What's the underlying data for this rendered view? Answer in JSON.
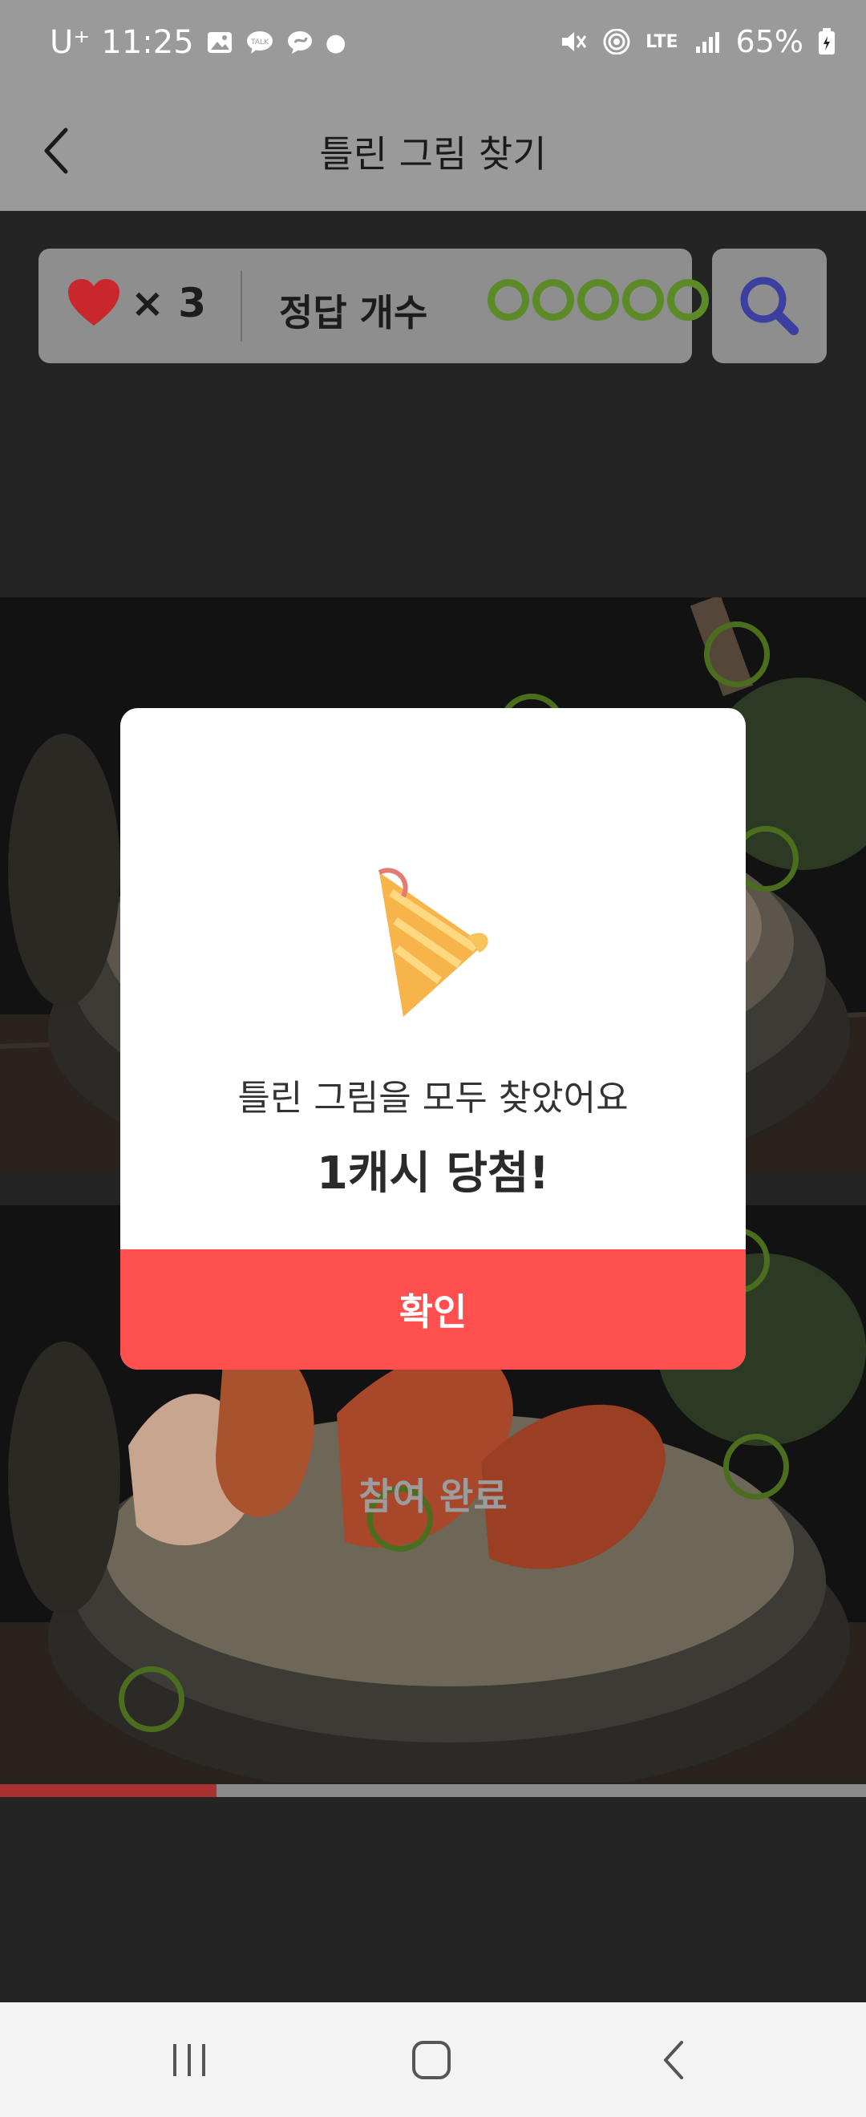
{
  "status_bar": {
    "carrier": "U⁺",
    "time": "11:25",
    "network": "LTE",
    "battery": "65%"
  },
  "header": {
    "title": "틀린 그림 찾기",
    "back_icon": "chevron-left-icon"
  },
  "game_bar": {
    "lives_icon": "heart-icon",
    "lives_count": "× 3",
    "answer_label": "정답 개수",
    "answers_found": 5,
    "search_icon": "magnifier-icon"
  },
  "game": {
    "done_label": "참여 완료",
    "progress_fraction": 0.25
  },
  "modal": {
    "icon": "party-popper-icon",
    "message": "틀린 그림을 모두 찾았어요",
    "prize": "1캐시 당첨!",
    "confirm_label": "확인"
  },
  "nav_bar": {
    "recent_icon": "recent-apps-icon",
    "home_icon": "home-icon",
    "back_icon": "back-icon"
  },
  "colors": {
    "accent": "#ff4f4f",
    "marker": "#5b8a27",
    "heart": "#c8282c"
  }
}
